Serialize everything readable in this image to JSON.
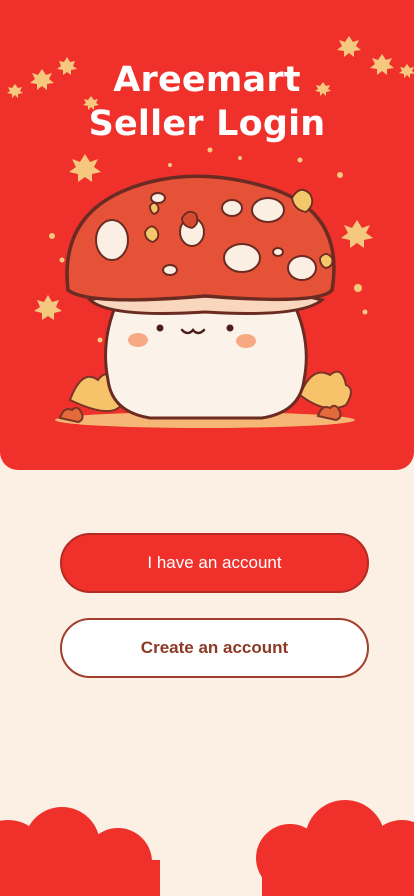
{
  "app": {
    "title_line1": "Areemart",
    "title_line2": "Seller Login"
  },
  "actions": {
    "login_label": "I have an account",
    "create_label": "Create an account"
  },
  "colors": {
    "brand_red": "#f0312b",
    "background": "#fcefe3",
    "secondary_text": "#8c3a26"
  },
  "illustration": {
    "icon": "mushroom-mascot-icon"
  }
}
